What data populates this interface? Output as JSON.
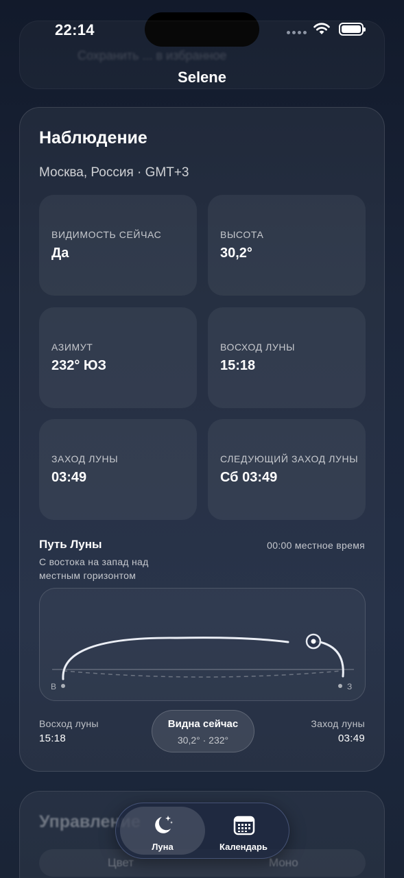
{
  "status_bar": {
    "time": "22:14"
  },
  "background_card": {
    "text": "Сохранить ... в избранное"
  },
  "nav": {
    "title": "Selene"
  },
  "observation": {
    "title": "Наблюдение",
    "location": "Москва, Россия · GMT+3",
    "tiles": [
      {
        "label": "Видимость сейчас",
        "value": "Да"
      },
      {
        "label": "Высота",
        "value": "30,2°"
      },
      {
        "label": "Азимут",
        "value": "232° ЮЗ"
      },
      {
        "label": "Восход луны",
        "value": "15:18"
      },
      {
        "label": "Заход луны",
        "value": "03:49"
      },
      {
        "label": "Следующий заход луны",
        "value": "Сб 03:49"
      }
    ],
    "moon_path": {
      "title": "Путь Луны",
      "description": "С востока на запад над местным горизонтом",
      "time_label": "00:00 местное время",
      "east_label": "В",
      "west_label": "З",
      "rise_label": "Восход луны",
      "rise_time": "15:18",
      "set_label": "Заход луны",
      "set_time": "03:49",
      "visible_title": "Видна сейчас",
      "visible_detail": "30,2° · 232°"
    }
  },
  "controls": {
    "title": "Управление",
    "segments": [
      "Цвет",
      "Моно"
    ]
  },
  "tabbar": {
    "items": [
      {
        "label": "Луна",
        "icon": "moon-stars-icon",
        "selected": true
      },
      {
        "label": "Календарь",
        "icon": "calendar-icon",
        "selected": false
      }
    ]
  },
  "colors": {
    "background": "#1a2438",
    "card": "#2a3447",
    "accent": "#ffffff"
  }
}
